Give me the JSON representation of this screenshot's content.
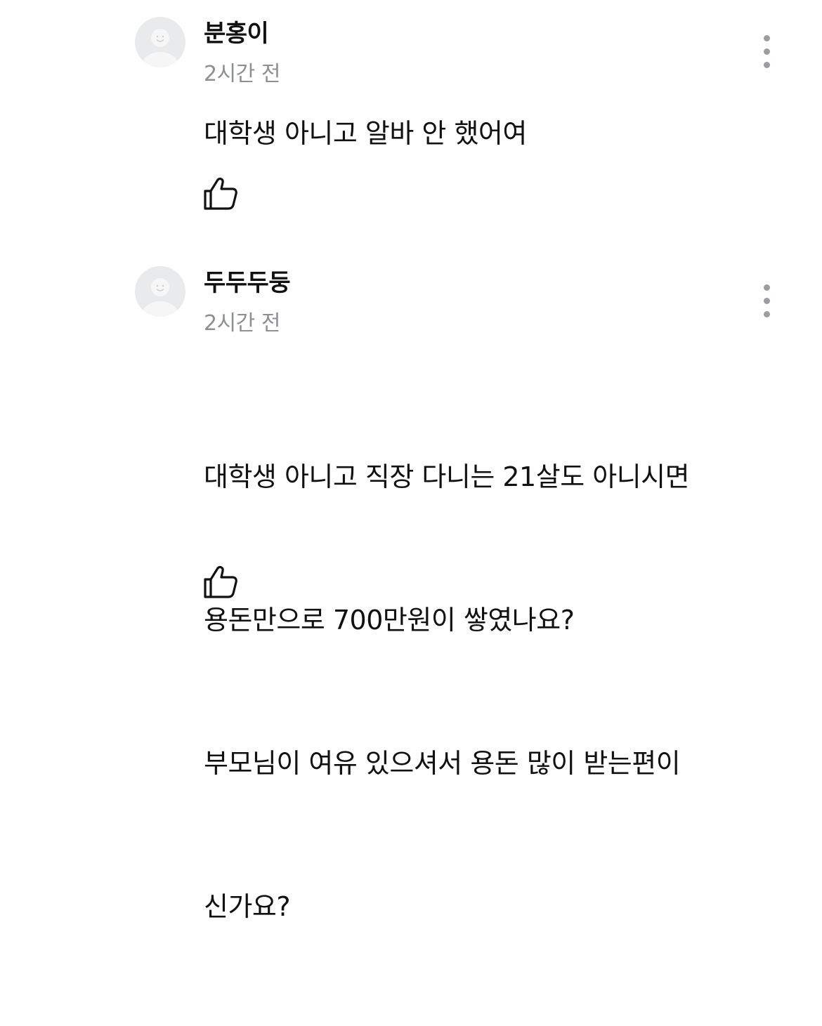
{
  "comments": [
    {
      "author": "분홍이",
      "time": "2시간 전",
      "body": "대학생 아니고 알바 안 했어여",
      "avatar_icon": "default-profile-face-icon",
      "more_icon": "more-vertical-icon",
      "like_icon": "thumbs-up-icon"
    },
    {
      "author": "두두두둥",
      "time": "2시간 전",
      "body_lines": [
        "대학생 아니고 직장 다니는 21살도 아니시면",
        "용돈만으로 700만원이 쌓였나요?",
        "부모님이 여유 있으셔서 용돈 많이 받는편이",
        "신가요?"
      ],
      "avatar_icon": "default-profile-face-icon",
      "more_icon": "more-vertical-icon",
      "like_icon": "thumbs-up-icon"
    }
  ],
  "colors": {
    "text_primary": "#111111",
    "text_secondary": "#8c8f94",
    "avatar_bg": "#e9eaec",
    "icon_gray": "#9a9da2"
  }
}
